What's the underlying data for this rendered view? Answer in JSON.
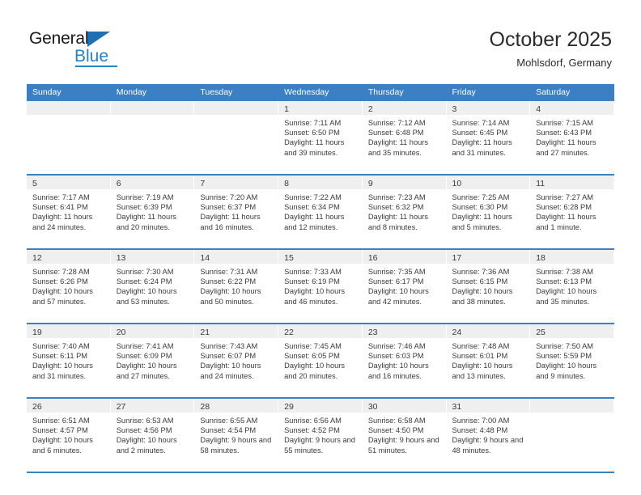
{
  "brand": {
    "name_part1": "General",
    "name_part2": "Blue",
    "triangle_color": "#1f6fb4",
    "blue_color": "#2383c4"
  },
  "header": {
    "title": "October 2025",
    "subtitle": "Mohlsdorf, Germany"
  },
  "theme": {
    "header_blue": "#3b7fc4",
    "day_band_gray": "#efefef",
    "text_color": "#3a3a3a"
  },
  "weekday_headers": [
    "Sunday",
    "Monday",
    "Tuesday",
    "Wednesday",
    "Thursday",
    "Friday",
    "Saturday"
  ],
  "weeks": [
    [
      {
        "empty": true
      },
      {
        "empty": true
      },
      {
        "empty": true
      },
      {
        "empty": false,
        "day": "1",
        "sunrise": "Sunrise: 7:11 AM",
        "sunset": "Sunset: 6:50 PM",
        "daylight": "Daylight: 11 hours and 39 minutes."
      },
      {
        "empty": false,
        "day": "2",
        "sunrise": "Sunrise: 7:12 AM",
        "sunset": "Sunset: 6:48 PM",
        "daylight": "Daylight: 11 hours and 35 minutes."
      },
      {
        "empty": false,
        "day": "3",
        "sunrise": "Sunrise: 7:14 AM",
        "sunset": "Sunset: 6:45 PM",
        "daylight": "Daylight: 11 hours and 31 minutes."
      },
      {
        "empty": false,
        "day": "4",
        "sunrise": "Sunrise: 7:15 AM",
        "sunset": "Sunset: 6:43 PM",
        "daylight": "Daylight: 11 hours and 27 minutes."
      }
    ],
    [
      {
        "empty": false,
        "day": "5",
        "sunrise": "Sunrise: 7:17 AM",
        "sunset": "Sunset: 6:41 PM",
        "daylight": "Daylight: 11 hours and 24 minutes."
      },
      {
        "empty": false,
        "day": "6",
        "sunrise": "Sunrise: 7:19 AM",
        "sunset": "Sunset: 6:39 PM",
        "daylight": "Daylight: 11 hours and 20 minutes."
      },
      {
        "empty": false,
        "day": "7",
        "sunrise": "Sunrise: 7:20 AM",
        "sunset": "Sunset: 6:37 PM",
        "daylight": "Daylight: 11 hours and 16 minutes."
      },
      {
        "empty": false,
        "day": "8",
        "sunrise": "Sunrise: 7:22 AM",
        "sunset": "Sunset: 6:34 PM",
        "daylight": "Daylight: 11 hours and 12 minutes."
      },
      {
        "empty": false,
        "day": "9",
        "sunrise": "Sunrise: 7:23 AM",
        "sunset": "Sunset: 6:32 PM",
        "daylight": "Daylight: 11 hours and 8 minutes."
      },
      {
        "empty": false,
        "day": "10",
        "sunrise": "Sunrise: 7:25 AM",
        "sunset": "Sunset: 6:30 PM",
        "daylight": "Daylight: 11 hours and 5 minutes."
      },
      {
        "empty": false,
        "day": "11",
        "sunrise": "Sunrise: 7:27 AM",
        "sunset": "Sunset: 6:28 PM",
        "daylight": "Daylight: 11 hours and 1 minute."
      }
    ],
    [
      {
        "empty": false,
        "day": "12",
        "sunrise": "Sunrise: 7:28 AM",
        "sunset": "Sunset: 6:26 PM",
        "daylight": "Daylight: 10 hours and 57 minutes."
      },
      {
        "empty": false,
        "day": "13",
        "sunrise": "Sunrise: 7:30 AM",
        "sunset": "Sunset: 6:24 PM",
        "daylight": "Daylight: 10 hours and 53 minutes."
      },
      {
        "empty": false,
        "day": "14",
        "sunrise": "Sunrise: 7:31 AM",
        "sunset": "Sunset: 6:22 PM",
        "daylight": "Daylight: 10 hours and 50 minutes."
      },
      {
        "empty": false,
        "day": "15",
        "sunrise": "Sunrise: 7:33 AM",
        "sunset": "Sunset: 6:19 PM",
        "daylight": "Daylight: 10 hours and 46 minutes."
      },
      {
        "empty": false,
        "day": "16",
        "sunrise": "Sunrise: 7:35 AM",
        "sunset": "Sunset: 6:17 PM",
        "daylight": "Daylight: 10 hours and 42 minutes."
      },
      {
        "empty": false,
        "day": "17",
        "sunrise": "Sunrise: 7:36 AM",
        "sunset": "Sunset: 6:15 PM",
        "daylight": "Daylight: 10 hours and 38 minutes."
      },
      {
        "empty": false,
        "day": "18",
        "sunrise": "Sunrise: 7:38 AM",
        "sunset": "Sunset: 6:13 PM",
        "daylight": "Daylight: 10 hours and 35 minutes."
      }
    ],
    [
      {
        "empty": false,
        "day": "19",
        "sunrise": "Sunrise: 7:40 AM",
        "sunset": "Sunset: 6:11 PM",
        "daylight": "Daylight: 10 hours and 31 minutes."
      },
      {
        "empty": false,
        "day": "20",
        "sunrise": "Sunrise: 7:41 AM",
        "sunset": "Sunset: 6:09 PM",
        "daylight": "Daylight: 10 hours and 27 minutes."
      },
      {
        "empty": false,
        "day": "21",
        "sunrise": "Sunrise: 7:43 AM",
        "sunset": "Sunset: 6:07 PM",
        "daylight": "Daylight: 10 hours and 24 minutes."
      },
      {
        "empty": false,
        "day": "22",
        "sunrise": "Sunrise: 7:45 AM",
        "sunset": "Sunset: 6:05 PM",
        "daylight": "Daylight: 10 hours and 20 minutes."
      },
      {
        "empty": false,
        "day": "23",
        "sunrise": "Sunrise: 7:46 AM",
        "sunset": "Sunset: 6:03 PM",
        "daylight": "Daylight: 10 hours and 16 minutes."
      },
      {
        "empty": false,
        "day": "24",
        "sunrise": "Sunrise: 7:48 AM",
        "sunset": "Sunset: 6:01 PM",
        "daylight": "Daylight: 10 hours and 13 minutes."
      },
      {
        "empty": false,
        "day": "25",
        "sunrise": "Sunrise: 7:50 AM",
        "sunset": "Sunset: 5:59 PM",
        "daylight": "Daylight: 10 hours and 9 minutes."
      }
    ],
    [
      {
        "empty": false,
        "day": "26",
        "sunrise": "Sunrise: 6:51 AM",
        "sunset": "Sunset: 4:57 PM",
        "daylight": "Daylight: 10 hours and 6 minutes."
      },
      {
        "empty": false,
        "day": "27",
        "sunrise": "Sunrise: 6:53 AM",
        "sunset": "Sunset: 4:56 PM",
        "daylight": "Daylight: 10 hours and 2 minutes."
      },
      {
        "empty": false,
        "day": "28",
        "sunrise": "Sunrise: 6:55 AM",
        "sunset": "Sunset: 4:54 PM",
        "daylight": "Daylight: 9 hours and 58 minutes."
      },
      {
        "empty": false,
        "day": "29",
        "sunrise": "Sunrise: 6:56 AM",
        "sunset": "Sunset: 4:52 PM",
        "daylight": "Daylight: 9 hours and 55 minutes."
      },
      {
        "empty": false,
        "day": "30",
        "sunrise": "Sunrise: 6:58 AM",
        "sunset": "Sunset: 4:50 PM",
        "daylight": "Daylight: 9 hours and 51 minutes."
      },
      {
        "empty": false,
        "day": "31",
        "sunrise": "Sunrise: 7:00 AM",
        "sunset": "Sunset: 4:48 PM",
        "daylight": "Daylight: 9 hours and 48 minutes."
      },
      {
        "empty": true
      }
    ]
  ]
}
